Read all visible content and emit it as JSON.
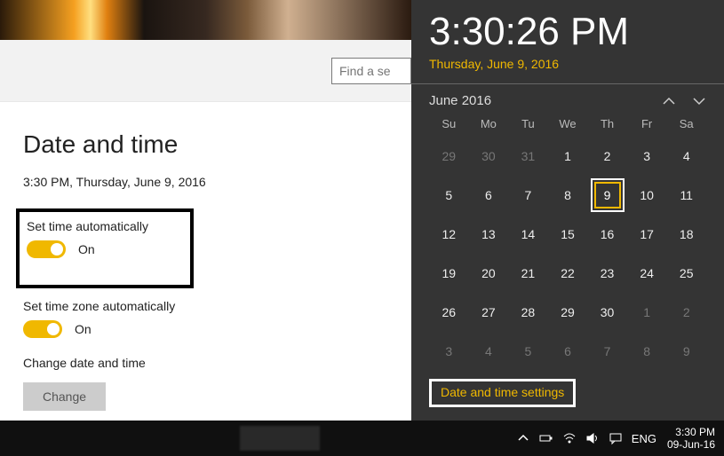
{
  "search": {
    "placeholder": "Find a se"
  },
  "settings": {
    "heading": "Date and time",
    "now": "3:30 PM, Thursday, June 9, 2016",
    "auto_time": {
      "label": "Set time automatically",
      "state": "On"
    },
    "auto_tz": {
      "label": "Set time zone automatically",
      "state": "On"
    },
    "change": {
      "label": "Change date and time",
      "button": "Change"
    }
  },
  "flyout": {
    "time": "3:30:26 PM",
    "date": "Thursday, June 9, 2016",
    "month": "June 2016",
    "dow": [
      "Su",
      "Mo",
      "Tu",
      "We",
      "Th",
      "Fr",
      "Sa"
    ],
    "weeks": [
      [
        {
          "n": 29,
          "m": true
        },
        {
          "n": 30,
          "m": true
        },
        {
          "n": 31,
          "m": true
        },
        {
          "n": 1
        },
        {
          "n": 2
        },
        {
          "n": 3
        },
        {
          "n": 4
        }
      ],
      [
        {
          "n": 5
        },
        {
          "n": 6
        },
        {
          "n": 7
        },
        {
          "n": 8
        },
        {
          "n": 9,
          "today": true
        },
        {
          "n": 10
        },
        {
          "n": 11
        }
      ],
      [
        {
          "n": 12
        },
        {
          "n": 13
        },
        {
          "n": 14
        },
        {
          "n": 15
        },
        {
          "n": 16
        },
        {
          "n": 17
        },
        {
          "n": 18
        }
      ],
      [
        {
          "n": 19
        },
        {
          "n": 20
        },
        {
          "n": 21
        },
        {
          "n": 22
        },
        {
          "n": 23
        },
        {
          "n": 24
        },
        {
          "n": 25
        }
      ],
      [
        {
          "n": 26
        },
        {
          "n": 27
        },
        {
          "n": 28
        },
        {
          "n": 29
        },
        {
          "n": 30
        },
        {
          "n": 1,
          "m": true
        },
        {
          "n": 2,
          "m": true
        }
      ],
      [
        {
          "n": 3,
          "m": true
        },
        {
          "n": 4,
          "m": true
        },
        {
          "n": 5,
          "m": true
        },
        {
          "n": 6,
          "m": true
        },
        {
          "n": 7,
          "m": true
        },
        {
          "n": 8,
          "m": true
        },
        {
          "n": 9,
          "m": true
        }
      ]
    ],
    "link": "Date and time settings"
  },
  "taskbar": {
    "lang": "ENG",
    "time": "3:30 PM",
    "date": "09-Jun-16"
  }
}
